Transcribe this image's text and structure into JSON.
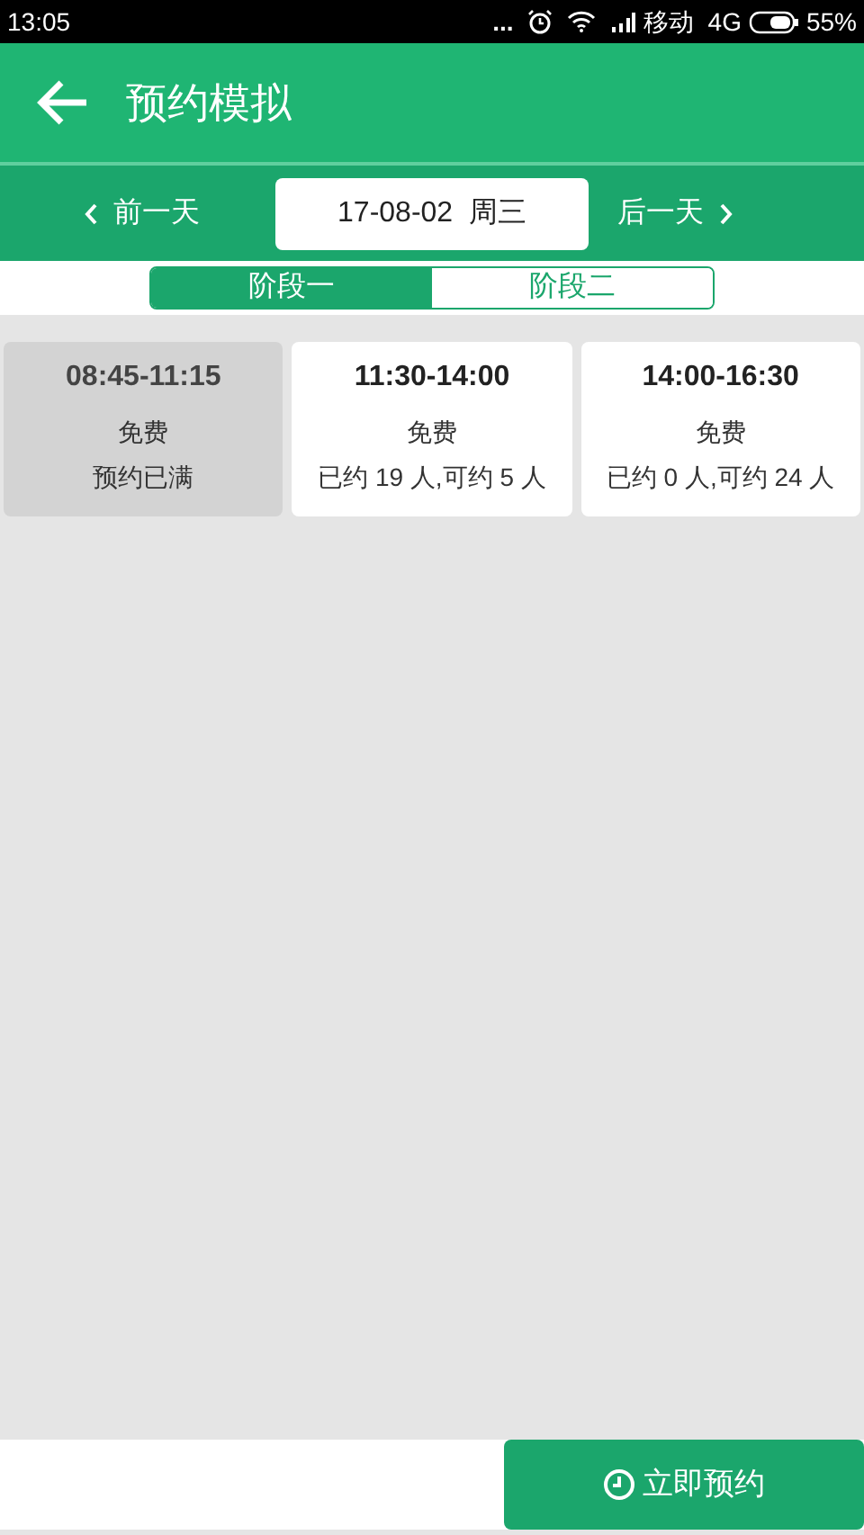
{
  "status_bar": {
    "time": "13:05",
    "dots": "...",
    "carrier": "移动",
    "network": "4G",
    "battery": "55%"
  },
  "header": {
    "title": "预约模拟"
  },
  "date_bar": {
    "prev": "前一天",
    "date": "17-08-02  周三",
    "next": "后一天"
  },
  "tabs": [
    {
      "label": "阶段一",
      "selected": true
    },
    {
      "label": "阶段二",
      "selected": false
    }
  ],
  "slots": [
    {
      "time": "08:45-11:15",
      "price": "免费",
      "status": "预约已满",
      "full": true
    },
    {
      "time": "11:30-14:00",
      "price": "免费",
      "status": "已约 19 人,可约 5 人",
      "full": false
    },
    {
      "time": "14:00-16:30",
      "price": "免费",
      "status": "已约 0 人,可约 24 人",
      "full": false
    }
  ],
  "book_button": "立即预约"
}
